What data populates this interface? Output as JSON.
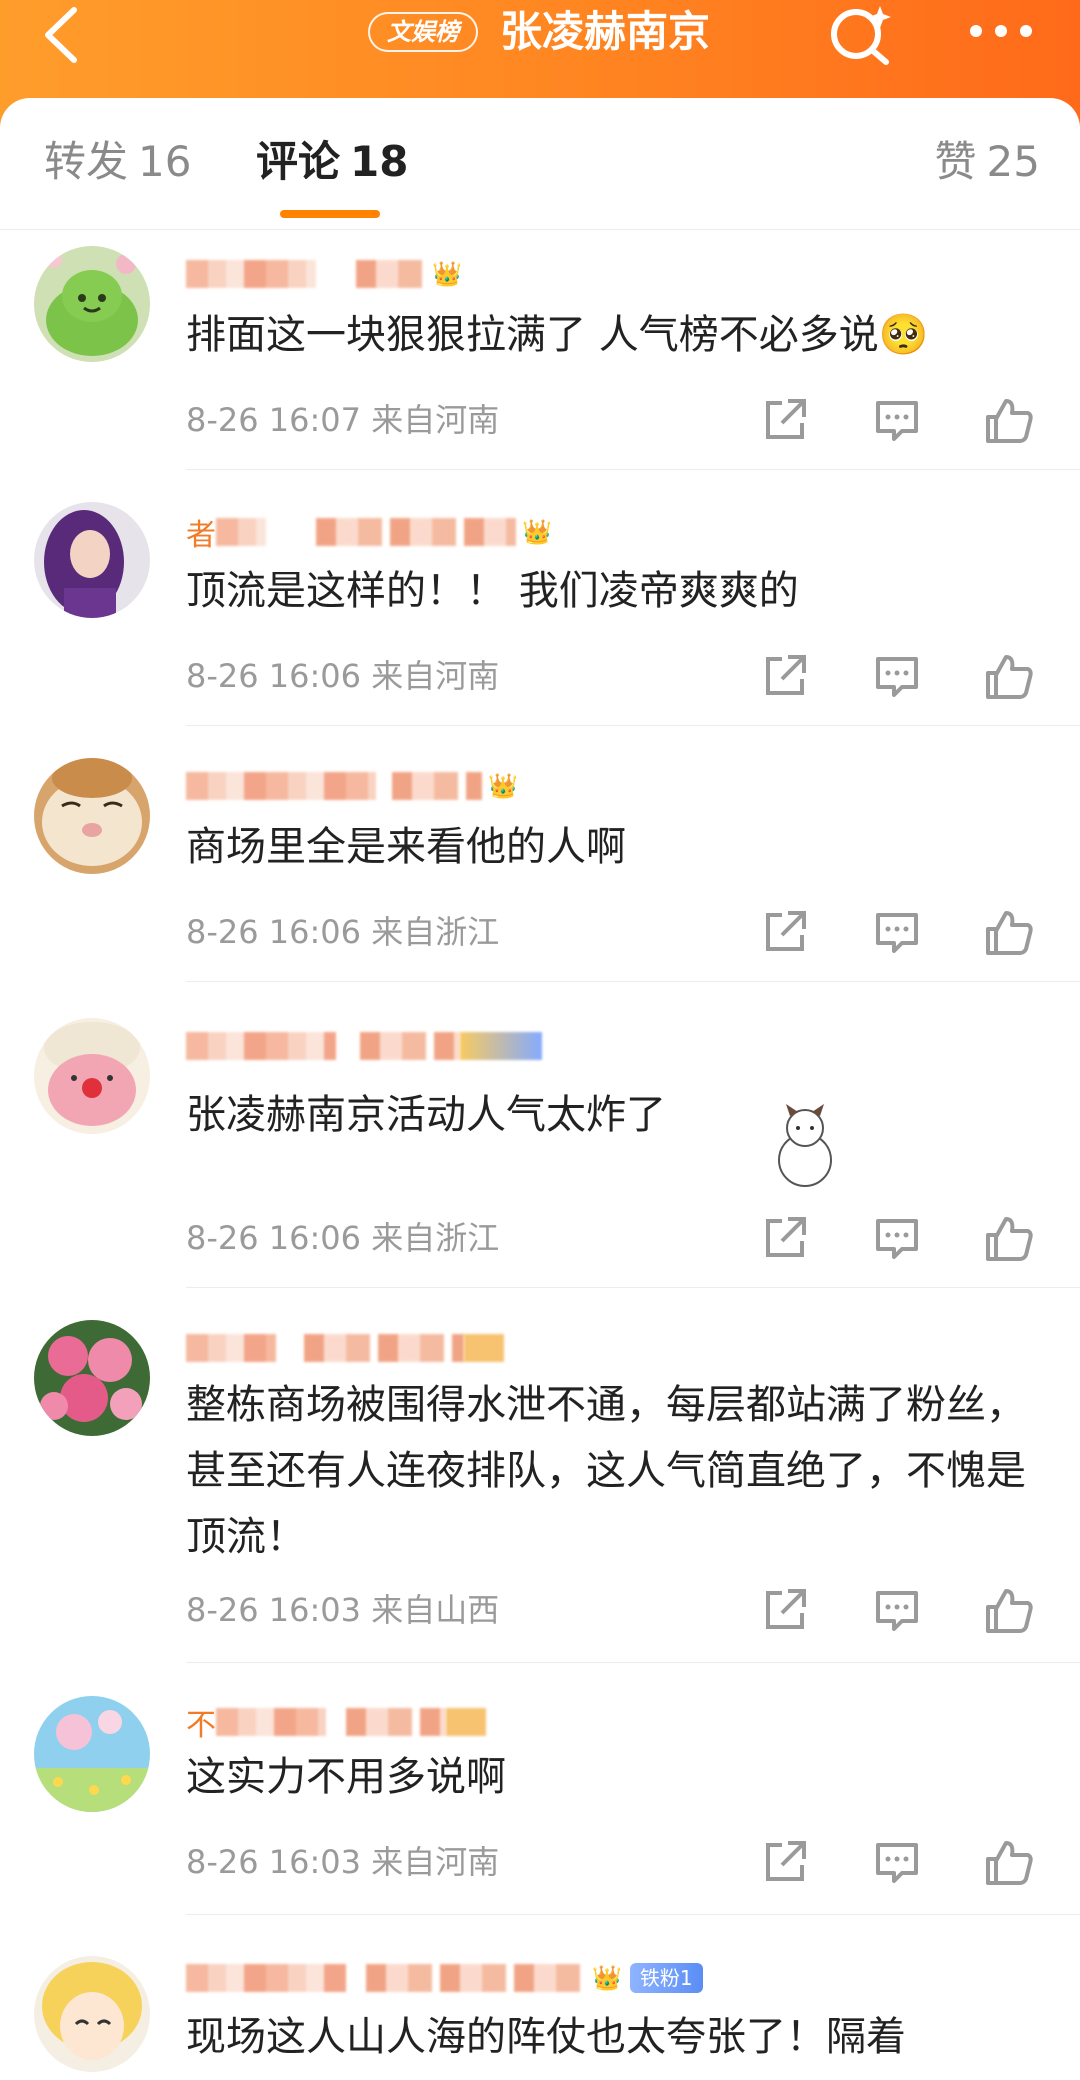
{
  "header": {
    "back_icon": "chevron-left-icon",
    "badge": "文娱榜",
    "title": "张凌赫南京",
    "search_icon": "search-sparkle-icon",
    "more_icon": "more-horizontal-icon"
  },
  "tabs": {
    "repost": {
      "label": "转发",
      "count": "16"
    },
    "comment": {
      "label": "评论",
      "count": "18"
    },
    "like": {
      "label": "赞",
      "count": "25"
    }
  },
  "comments": [
    {
      "avatar": "green-frog-avatar",
      "text": "排面这一块狠狠拉满了 人气榜不必多说",
      "emoji": "🥺",
      "time": "8-26 16:07",
      "location": "来自河南"
    },
    {
      "avatar": "purple-hair-girl-avatar",
      "username_prefix": "者",
      "text": "顶流是这样的！！ 我们凌帝爽爽的",
      "time": "8-26 16:06",
      "location": "来自河南"
    },
    {
      "avatar": "cat-face-avatar",
      "text": "商场里全是来看他的人啊",
      "time": "8-26 16:06",
      "location": "来自浙江"
    },
    {
      "avatar": "pink-blob-avatar",
      "text": "张凌赫南京活动人气太炸了",
      "time": "8-26 16:06",
      "location": "来自浙江"
    },
    {
      "avatar": "pink-roses-avatar",
      "text": "整栋商场被围得水泄不通，每层都站满了粉丝，甚至还有人连夜排队，这人气简直绝了，不愧是顶流！",
      "time": "8-26 16:03",
      "location": "来自山西"
    },
    {
      "avatar": "flower-field-avatar",
      "username_prefix": "不",
      "text": "这实力不用多说啊",
      "time": "8-26 16:03",
      "location": "来自河南"
    },
    {
      "avatar": "anime-girl-avatar",
      "fan_badge": "铁粉1",
      "text": "现场这人山人海的阵仗也太夸张了！隔着",
      "time": "",
      "location": ""
    }
  ],
  "colors": {
    "brand_orange": "#ff8200",
    "username": "#f07c2a",
    "meta_gray": "#9a9a9a"
  }
}
